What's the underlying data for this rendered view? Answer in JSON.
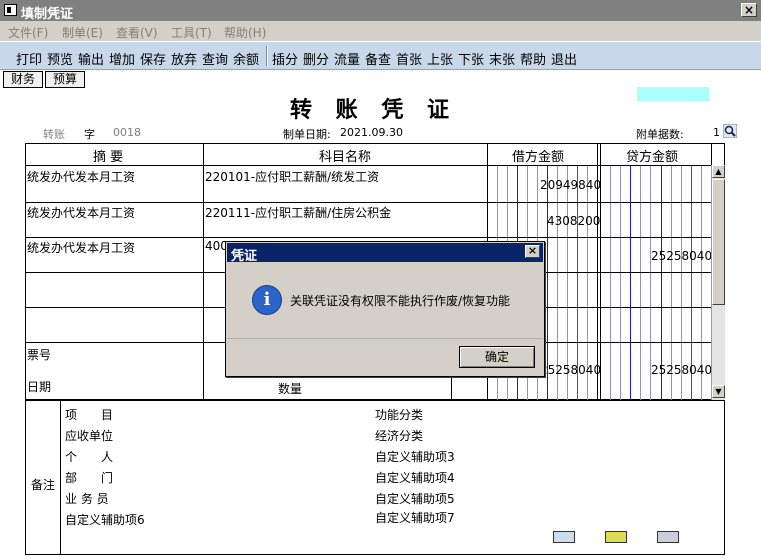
{
  "window": {
    "title": "填制凭证",
    "close_label": "×"
  },
  "menu": [
    "文件(F)",
    "制单(E)",
    "查看(V)",
    "工具(T)",
    "帮助(H)"
  ],
  "toolbar": [
    "打印",
    "预览",
    "输出",
    "增加",
    "保存",
    "放弃",
    "查询",
    "余额",
    "插分",
    "删分",
    "流量",
    "备查",
    "首张",
    "上张",
    "下张",
    "末张",
    "帮助",
    "退出"
  ],
  "tabs": [
    "财务",
    "预算"
  ],
  "voucher": {
    "title": "转 账 凭 证",
    "type": "转账",
    "zi": "字",
    "number": "0018",
    "date_label": "制单日期:",
    "date": "2021.09.30",
    "attach_label": "附单据数:",
    "attach_count": "1"
  },
  "columns": {
    "summary": "摘 要",
    "account": "科目名称",
    "debit": "借方金额",
    "credit": "贷方金额"
  },
  "rows": [
    {
      "summary": "统发办代发本月工资",
      "account": "220101-应付职工薪酬/统发工资",
      "debit": "20949840",
      "credit": ""
    },
    {
      "summary": "统发办代发本月工资",
      "account": "220111-应付职工薪酬/住房公积金",
      "debit": "4308200",
      "credit": ""
    },
    {
      "summary": "统发办代发本月工资",
      "account": "400",
      "debit": "",
      "credit": "25258040"
    }
  ],
  "footer_row": {
    "piao_label": "票号",
    "date_label": "日期",
    "qty_label": "数量",
    "debit_total": "25258040",
    "credit_total": "25258040"
  },
  "remarks": {
    "label": "备注",
    "left": [
      "项　　目",
      "应收单位",
      "个　　人",
      "部　　门",
      "业 务 员",
      "自定义辅助项6"
    ],
    "right": [
      "功能分类",
      "经济分类",
      "自定义辅助项3",
      "自定义辅助项4",
      "自定义辅助项5",
      "自定义辅助项7"
    ]
  },
  "dialog": {
    "title": "凭证",
    "close_label": "×",
    "icon_glyph": "i",
    "message": "关联凭证没有权限不能执行作废/恢复功能",
    "ok_label": "确定"
  },
  "scroll": {
    "up": "▲",
    "down": "▼"
  },
  "colors": {
    "titlebar": "#808080",
    "dialog_title": "#0a246a",
    "toolbar": "#c8d8ea",
    "cyan": "#aaffff"
  }
}
